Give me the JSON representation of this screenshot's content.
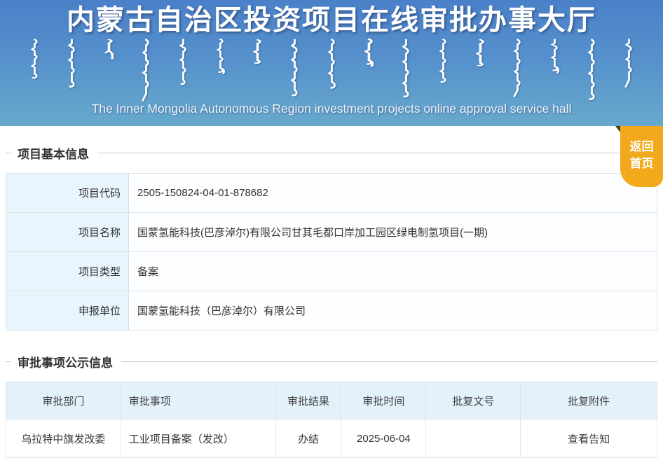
{
  "header": {
    "title_cn": "内蒙古自治区投资项目在线审批办事大厅",
    "subtitle_en": "The Inner Mongolia Autonomous Region investment projects online approval service hall"
  },
  "ribbon": {
    "line1": "返回",
    "line2": "首页"
  },
  "sections": {
    "basic_info": {
      "title": "项目基本信息",
      "rows": [
        {
          "label": "项目代码",
          "value": "2505-150824-04-01-878682"
        },
        {
          "label": "项目名称",
          "value": "国蒙氢能科技(巴彦淖尔)有限公司甘其毛都口岸加工园区绿电制氢项目(一期)"
        },
        {
          "label": "项目类型",
          "value": "备案"
        },
        {
          "label": "申报单位",
          "value": "国蒙氢能科技（巴彦淖尔）有限公司"
        }
      ]
    },
    "approval_info": {
      "title": "审批事项公示信息",
      "columns": [
        "审批部门",
        "审批事项",
        "审批结果",
        "审批时间",
        "批复文号",
        "批复附件"
      ],
      "rows": [
        {
          "department": "乌拉特中旗发改委",
          "item": "工业项目备案（发改）",
          "result": "办结",
          "time": "2025-06-04",
          "doc_no": "",
          "attachment": "查看告知"
        }
      ]
    }
  },
  "colors": {
    "header_gradient_top": "#4a80c8",
    "header_gradient_bottom": "#67a9cd",
    "ribbon_orange": "#f2a91c",
    "label_cell_blue": "#e9f5fd",
    "table_header_blue": "#e3f1fb"
  }
}
